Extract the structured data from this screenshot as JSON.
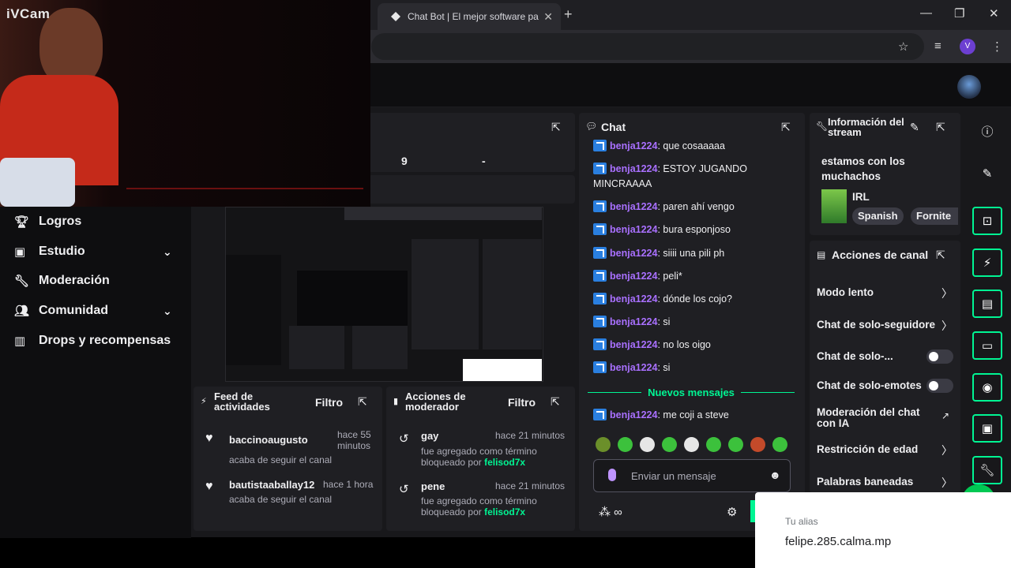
{
  "browser": {
    "tab_title": "Chat Bot | El mejor software pa",
    "new_tab": "+",
    "profile_initial": "V"
  },
  "webcam": {
    "label": "iVCam"
  },
  "sidebar": {
    "items": [
      {
        "label": "Logros",
        "icon": "trophy-icon"
      },
      {
        "label": "Estudio",
        "icon": "studio-icon",
        "expandable": true
      },
      {
        "label": "Moderación",
        "icon": "wrench-icon"
      },
      {
        "label": "Comunidad",
        "icon": "community-icon",
        "expandable": true
      },
      {
        "label": "Drops y recompensas",
        "icon": "drops-icon"
      }
    ]
  },
  "stats": {
    "value_1": "9",
    "value_2": "-"
  },
  "chat": {
    "title": "Chat",
    "messages": [
      {
        "user": "benja1224",
        "text": ": que cosaaaaa"
      },
      {
        "user": "benja1224",
        "text": ": ESTOY JUGANDO MINCRAAAA"
      },
      {
        "user": "benja1224",
        "text": ": paren ahí vengo"
      },
      {
        "user": "benja1224",
        "text": ": bura esponjoso"
      },
      {
        "user": "benja1224",
        "text": ": siiii una pili ph"
      },
      {
        "user": "benja1224",
        "text": ": peli*"
      },
      {
        "user": "benja1224",
        "text": ": dónde los cojo?"
      },
      {
        "user": "benja1224",
        "text": ": si"
      },
      {
        "user": "benja1224",
        "text": ": no los oigo"
      },
      {
        "user": "benja1224",
        "text": ": si"
      }
    ],
    "new_messages_label": "Nuevos mensajes",
    "new_message": {
      "user": "benja1224",
      "text": ": me coji a steve"
    },
    "input_placeholder": "Enviar un mensaje",
    "footer_symbol": "∞"
  },
  "stream_info": {
    "title": "Información del stream",
    "stream_title": "estamos con los muchachos",
    "category": "IRL",
    "tags": [
      "Spanish",
      "Fornite"
    ]
  },
  "channel_actions": {
    "title": "Acciones de canal",
    "items": [
      {
        "label": "Modo lento",
        "control": "chevron"
      },
      {
        "label": "Chat de solo-seguidore",
        "control": "chevron"
      },
      {
        "label": "Chat de solo-...",
        "control": "toggle",
        "value": false
      },
      {
        "label": "Chat de solo-emotes",
        "control": "toggle",
        "value": false
      },
      {
        "label": "Moderación del chat con IA",
        "control": "external"
      },
      {
        "label": "Restricción de edad",
        "control": "chevron"
      },
      {
        "label": "Palabras baneadas",
        "control": "chevron"
      }
    ]
  },
  "activity_feed": {
    "title": "Feed de actividades",
    "filter": "Filtro",
    "items": [
      {
        "user": "baccinoaugusto",
        "time": "hace 55 minutos",
        "action": "acaba de seguir el canal"
      },
      {
        "user": "bautistaaballay12",
        "time": "hace 1 hora",
        "action": "acaba de seguir el canal"
      }
    ]
  },
  "mod_actions": {
    "title": "Acciones de moderador",
    "filter": "Filtro",
    "items": [
      {
        "term": "gay",
        "time": "hace 21 minutos",
        "desc": "fue agregado como término bloqueado por",
        "by": "felisod7x"
      },
      {
        "term": "pene",
        "time": "hace 21 minutos",
        "desc": "fue agregado como término bloqueado por",
        "by": "felisod7x"
      }
    ]
  },
  "alias_popup": {
    "label": "Tu alias",
    "value": "felipe.285.calma.mp"
  },
  "colors": {
    "accent": "#00f593",
    "username": "#a970ff",
    "badge": "#2a7fe0"
  }
}
